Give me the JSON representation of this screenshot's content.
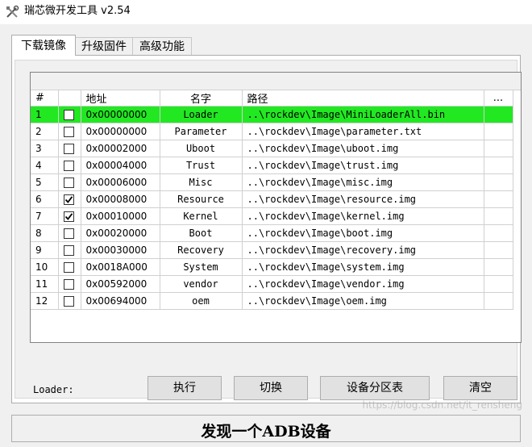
{
  "window": {
    "title": "瑞芯微开发工具 v2.54"
  },
  "tabs": [
    {
      "label": "下载镜像",
      "active": true
    },
    {
      "label": "升级固件",
      "active": false
    },
    {
      "label": "高级功能",
      "active": false
    }
  ],
  "table": {
    "headers": {
      "index": "#",
      "address": "地址",
      "name": "名字",
      "path": "路径",
      "more": "..."
    },
    "rows": [
      {
        "index": "1",
        "checked": false,
        "address": "0x00000000",
        "name": "Loader",
        "path": "..\\rockdev\\Image\\MiniLoaderAll.bin",
        "selected": true
      },
      {
        "index": "2",
        "checked": false,
        "address": "0x00000000",
        "name": "Parameter",
        "path": "..\\rockdev\\Image\\parameter.txt",
        "selected": false
      },
      {
        "index": "3",
        "checked": false,
        "address": "0x00002000",
        "name": "Uboot",
        "path": "..\\rockdev\\Image\\uboot.img",
        "selected": false
      },
      {
        "index": "4",
        "checked": false,
        "address": "0x00004000",
        "name": "Trust",
        "path": "..\\rockdev\\Image\\trust.img",
        "selected": false
      },
      {
        "index": "5",
        "checked": false,
        "address": "0x00006000",
        "name": "Misc",
        "path": "..\\rockdev\\Image\\misc.img",
        "selected": false
      },
      {
        "index": "6",
        "checked": true,
        "address": "0x00008000",
        "name": "Resource",
        "path": "..\\rockdev\\Image\\resource.img",
        "selected": false
      },
      {
        "index": "7",
        "checked": true,
        "address": "0x00010000",
        "name": "Kernel",
        "path": "..\\rockdev\\Image\\kernel.img",
        "selected": false
      },
      {
        "index": "8",
        "checked": false,
        "address": "0x00020000",
        "name": "Boot",
        "path": "..\\rockdev\\Image\\boot.img",
        "selected": false
      },
      {
        "index": "9",
        "checked": false,
        "address": "0x00030000",
        "name": "Recovery",
        "path": "..\\rockdev\\Image\\recovery.img",
        "selected": false
      },
      {
        "index": "10",
        "checked": false,
        "address": "0x0018A000",
        "name": "System",
        "path": "..\\rockdev\\Image\\system.img",
        "selected": false
      },
      {
        "index": "11",
        "checked": false,
        "address": "0x00592000",
        "name": "vendor",
        "path": "..\\rockdev\\Image\\vendor.img",
        "selected": false
      },
      {
        "index": "12",
        "checked": false,
        "address": "0x00694000",
        "name": "oem",
        "path": "..\\rockdev\\Image\\oem.img",
        "selected": false
      }
    ]
  },
  "controls": {
    "loader_label": "Loader:",
    "execute": "执行",
    "switch": "切换",
    "partition_table": "设备分区表",
    "clear": "清空"
  },
  "status": {
    "message": "发现一个ADB设备"
  },
  "watermark": "https://blog.csdn.net/it_rensheng",
  "colors": {
    "selected_row": "#22e822",
    "button_bg": "#e1e1e1",
    "window_bg": "#f0f0f0"
  },
  "icons": {
    "app": "tools-icon",
    "checkbox_checked": "checkmark-icon"
  }
}
